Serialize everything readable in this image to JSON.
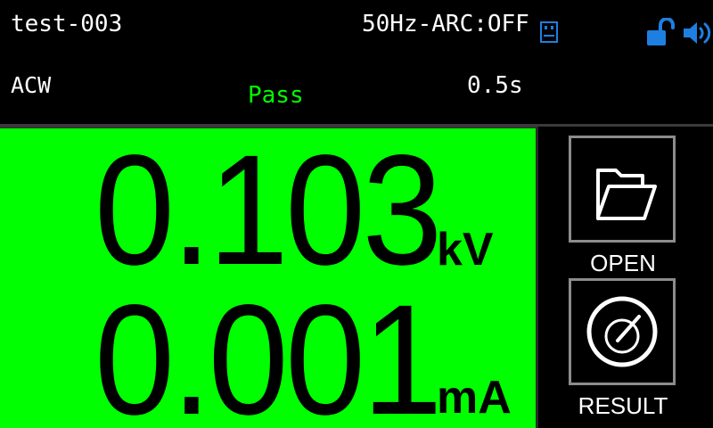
{
  "status_bar": {
    "file_name": "test-003",
    "arc_status": "50Hz-ARC:OFF",
    "icons": [
      "usb-icon",
      "unlock-icon",
      "speaker-icon"
    ]
  },
  "test_info": {
    "mode": "ACW",
    "result": "Pass",
    "time": "0.5s"
  },
  "measurement": {
    "voltage_value": "0.103",
    "voltage_unit": "kV",
    "current_value": "0.001",
    "current_unit": "mA"
  },
  "side_buttons": {
    "open_label": "OPEN",
    "result_label": "RESULT"
  },
  "colors": {
    "pass_green": "#00ff00",
    "panel_green": "#00ff00",
    "icon_blue": "#1e7fe0",
    "border_gray": "#8c8c8c"
  }
}
